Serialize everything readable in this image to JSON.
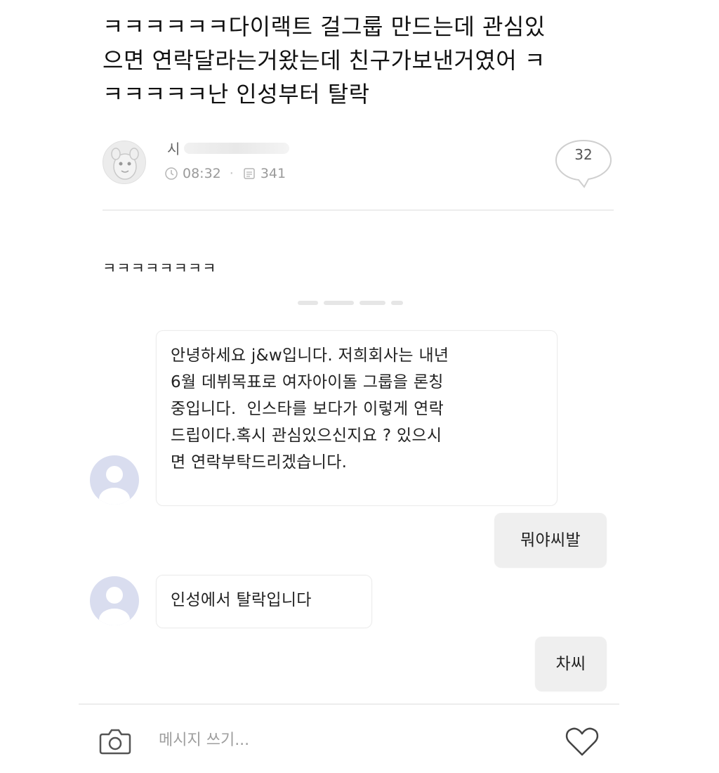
{
  "post": {
    "body": "ㅋㅋㅋㅋㅋㅋ다이랙트 걸그룹 만드는데 관심있\n으면 연락달라는거왔는데 친구가보낸거였어 ㅋ\nㅋㅋㅋㅋㅋ난 인성부터 탈락",
    "author": {
      "name_visible": "시",
      "time": "08:32",
      "views": "341"
    },
    "comment_count": "32"
  },
  "comment": {
    "text": "ㅋㅋㅋㅋㅋㅋㅋㅋ"
  },
  "chat": {
    "messages": [
      {
        "from": "other",
        "text": "안녕하세요 j&w입니다. 저희회사는 내년\n6월 데뷔목표로 여자아이돌 그룹을 론칭\n중입니다.  인스타를 보다가 이렇게 연락\n드립이다.혹시 관심있으신지요 ? 있으시\n면 연락부탁드리겠습니다."
      },
      {
        "from": "me",
        "text": "뭐야씨발"
      },
      {
        "from": "other",
        "text": "인성에서 탈락입니다"
      },
      {
        "from": "me",
        "text": "차씨"
      }
    ]
  },
  "composer": {
    "placeholder": "메시지 쓰기...",
    "camera_icon": "camera-icon",
    "like_icon": "heart-icon"
  },
  "colors": {
    "avatar_placeholder": "#d9ddef",
    "my_bubble": "#efefef",
    "divider": "#ededed"
  }
}
